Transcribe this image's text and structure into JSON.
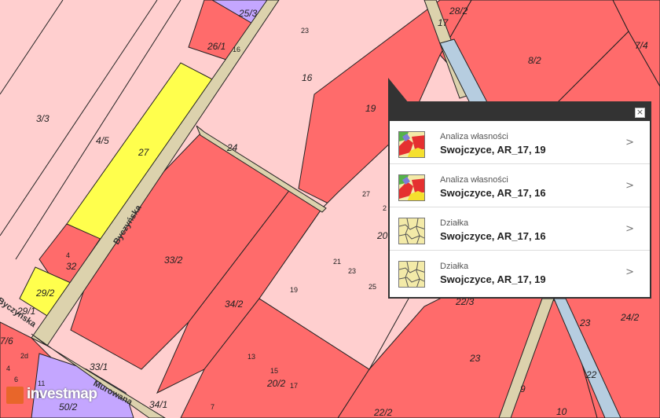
{
  "map": {
    "parcel_labels": [
      "25/3",
      "23",
      "28/2",
      "17",
      "26/1",
      "16",
      "16",
      "8/2",
      "7/4",
      "3/3",
      "4/5",
      "27",
      "19",
      "24",
      "27",
      "2",
      "20",
      "4",
      "32",
      "33/2",
      "21",
      "23",
      "25",
      "19",
      "29/2",
      "29/1",
      "34/2",
      "23",
      "24/2",
      "7/6",
      "2d",
      "13",
      "15",
      "17",
      "20/2",
      "23",
      "22",
      "11",
      "1",
      "33/1",
      "34/1",
      "7",
      "9",
      "10",
      "50/2",
      "22/2",
      "6",
      "4",
      "22/3"
    ],
    "street_names": [
      "Byczyńska",
      "Byczyńska",
      "Murowana"
    ]
  },
  "popup": {
    "close_label": "×",
    "items": [
      {
        "type": "Analiza własności",
        "name": "Swojczyce, AR_17, 19",
        "icon": "ownership-analysis-icon"
      },
      {
        "type": "Analiza własności",
        "name": "Swojczyce, AR_17, 16",
        "icon": "ownership-analysis-icon"
      },
      {
        "type": "Działka",
        "name": "Swojczyce, AR_17, 16",
        "icon": "parcel-icon"
      },
      {
        "type": "Działka",
        "name": "Swojczyce, AR_17, 19",
        "icon": "parcel-icon"
      }
    ],
    "chevron": ">"
  },
  "logo": {
    "text": "investmap"
  },
  "colors": {
    "parcel_light": "#ffcfcf",
    "parcel_red": "#ff6b6b",
    "parcel_yellow": "#ffff4d",
    "parcel_purple": "#c4a6ff",
    "road": "#dcd2ad",
    "water": "#b6cde0",
    "boundary": "#222222",
    "popup_dark": "#333333",
    "logo_orange": "#e8662a"
  }
}
